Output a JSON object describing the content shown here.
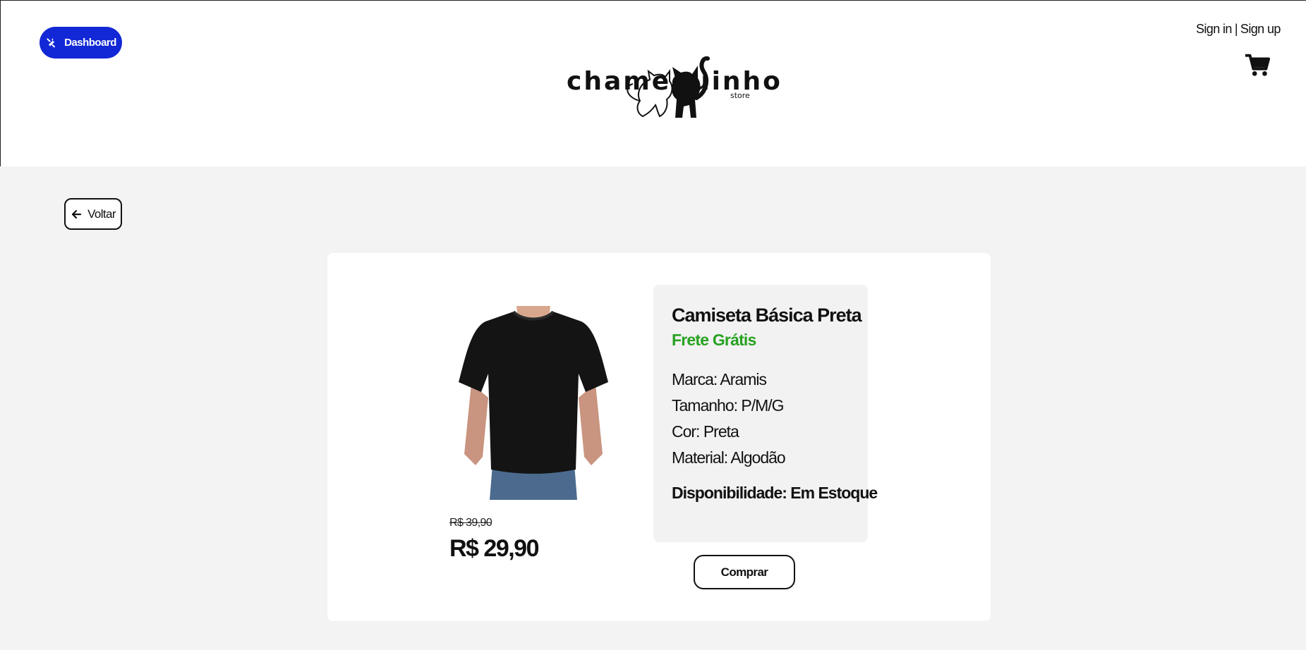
{
  "header": {
    "dashboard_label": "Dashboard",
    "logo_text": "chameguinho",
    "logo_sub": "store",
    "sign_in": "Sign in",
    "separator": "|",
    "sign_up": "Sign up",
    "cart_icon": "cart-icon"
  },
  "nav": {
    "back_label": "Voltar"
  },
  "product": {
    "title": "Camiseta Básica Preta",
    "shipping": "Frete Grátis",
    "specs": [
      "Marca: Aramis",
      "Tamanho: P/M/G",
      "Cor: Preta",
      "Material: Algodão"
    ],
    "availability": "Disponibilidade: Em Estoque",
    "old_price": "R$ 39,90",
    "price": "R$ 29,90",
    "buy_label": "Comprar"
  },
  "colors": {
    "dashboard_bg": "#1228d6",
    "shipping_green": "#27a121",
    "page_bg": "#f3f3f3"
  }
}
